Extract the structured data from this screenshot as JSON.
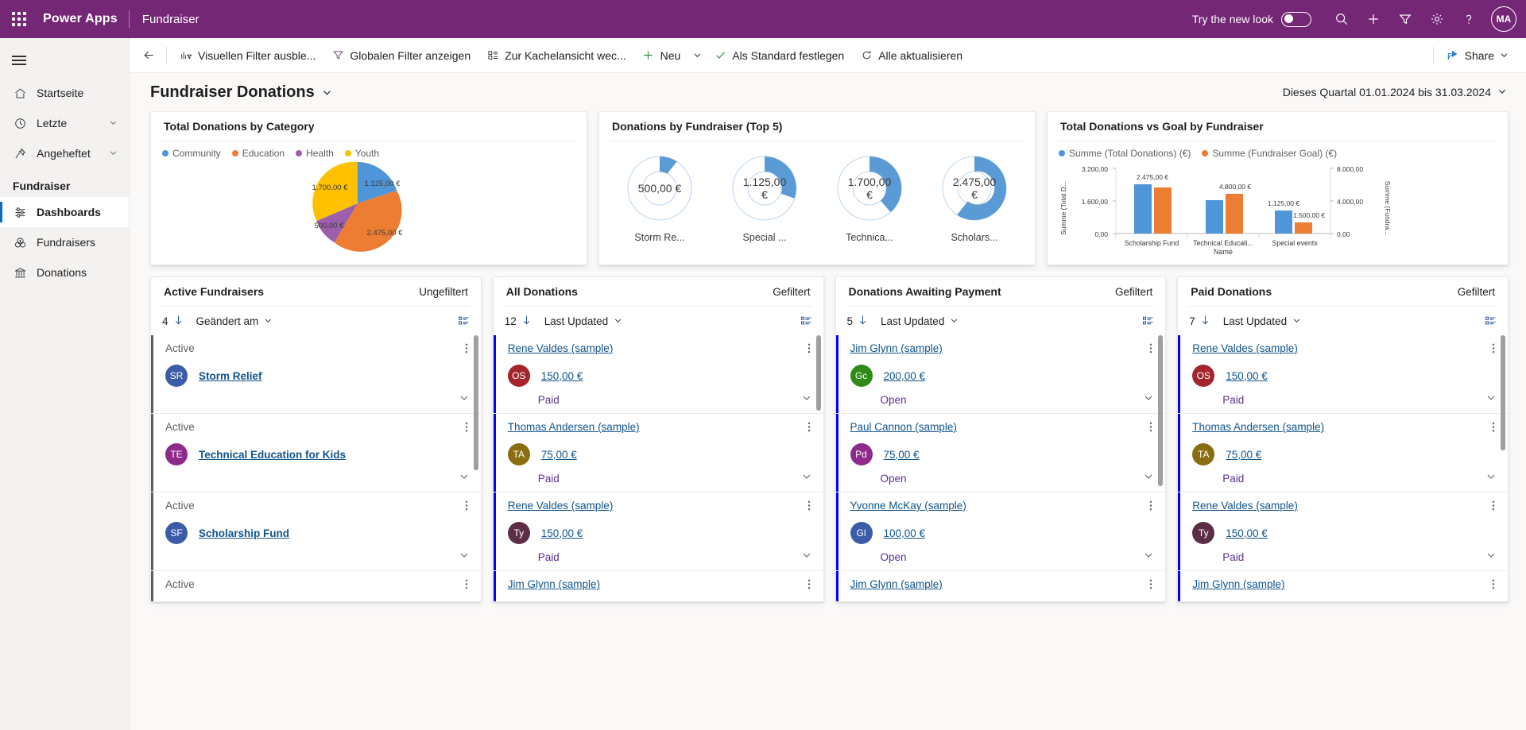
{
  "topbar": {
    "waffle_icon": "waffle-icon",
    "brand": "Power Apps",
    "app_name": "Fundraiser",
    "new_look_label": "Try the new look",
    "icons": [
      "search-icon",
      "plus-icon",
      "filter-icon",
      "gear-icon",
      "help-icon"
    ],
    "avatar_initials": "MA",
    "background_color": "#742774"
  },
  "sidebar": {
    "hamburger": "hamburger-icon",
    "items": [
      {
        "label": "Startseite",
        "icon": "home-icon",
        "chevron": false,
        "active": false
      },
      {
        "label": "Letzte",
        "icon": "clock-icon",
        "chevron": true,
        "active": false
      },
      {
        "label": "Angeheftet",
        "icon": "pin-icon",
        "chevron": true,
        "active": false
      }
    ],
    "section_label": "Fundraiser",
    "group_items": [
      {
        "label": "Dashboards",
        "icon": "dashboard-icon",
        "active": true
      },
      {
        "label": "Fundraisers",
        "icon": "money-icon",
        "active": false
      },
      {
        "label": "Donations",
        "icon": "bank-icon",
        "active": false
      }
    ]
  },
  "commandbar": {
    "back": "back-arrow-icon",
    "buttons": [
      {
        "label": "Visuellen Filter ausble...",
        "icon": "chart-filter-icon",
        "caret": false
      },
      {
        "label": "Globalen Filter anzeigen",
        "icon": "funnel-icon",
        "caret": false
      },
      {
        "label": "Zur Kachelansicht wec...",
        "icon": "tiles-icon",
        "caret": false
      },
      {
        "label": "Neu",
        "icon": "plus-icon",
        "caret": true
      },
      {
        "label": "Als Standard festlegen",
        "icon": "check-icon",
        "caret": false
      },
      {
        "label": "Alle aktualisieren",
        "icon": "refresh-icon",
        "caret": false
      }
    ],
    "share_label": "Share",
    "share_icon": "share-icon"
  },
  "dashboard": {
    "title": "Fundraiser Donations",
    "title_caret": "chevron-down-icon",
    "date_range": "Dieses Quartal 01.01.2024 bis 31.03.2024",
    "date_caret": "chevron-down-icon"
  },
  "chart_data": [
    {
      "type": "pie",
      "title": "Total Donations by Category",
      "categories": [
        "Community",
        "Education",
        "Health",
        "Youth"
      ],
      "values": [
        1125,
        2475,
        500,
        1700
      ],
      "labels": [
        "1.125,00 €",
        "2.475,00 €",
        "500,00 €",
        "1.700,00 €"
      ],
      "colors": [
        "#4e95d9",
        "#ec7d32",
        "#9c5fad",
        "#ffc000"
      ],
      "legend_position": "top"
    },
    {
      "type": "donut",
      "title": "Donations by Fundraiser (Top 5)",
      "categories": [
        "Storm Re...",
        "Special ...",
        "Technica...",
        "Scholars..."
      ],
      "values": [
        500,
        1125,
        1700,
        2475
      ],
      "labels": [
        "500,00 €",
        "1.125,00 €",
        "1.700,00 €",
        "2.475,00 €"
      ],
      "max": 3200,
      "arc_color": "#5b9bd5",
      "track_color": "#ffffff",
      "track_stroke": "#b9d5ef"
    },
    {
      "type": "bar",
      "title": "Total Donations vs Goal by Fundraiser",
      "categories": [
        "Scholarship Fund",
        "Technical Educati...",
        "Special events"
      ],
      "series": [
        {
          "name": "Summe (Total Donations) (€)",
          "color": "#4e95d9",
          "values": [
            2475,
            1650,
            1125
          ],
          "labels": [
            "2.475,00 €",
            "",
            "1.125,00 €"
          ]
        },
        {
          "name": "Summe (Fundraiser Goal) (€)",
          "color": "#ec7d32",
          "values": [
            6000,
            4800,
            1500
          ],
          "labels": [
            "",
            "4.800,00 €",
            "1.500,00 €"
          ]
        }
      ],
      "xlabel": "Name",
      "y_left_label": "Summe (Total D...",
      "y_right_label": "Summe (Fundra...",
      "y_left_ticks": [
        "0,00",
        "1.600,00",
        "3.200,00"
      ],
      "y_right_ticks": [
        "0,00",
        "4.000,00",
        "8.000,00"
      ],
      "ylim_left": [
        0,
        3200
      ],
      "ylim_right": [
        0,
        8000
      ],
      "grid": false,
      "legend_position": "top"
    }
  ],
  "lists": [
    {
      "title": "Active Fundraisers",
      "filter_status": "Ungefiltert",
      "count": "4",
      "sort_label": "Geändert am",
      "sort_icon": "sort-desc-icon",
      "view_icon": "list-view-icon",
      "accent": "grey",
      "rows": [
        {
          "header": "Active",
          "header_link": false,
          "initials": "SR",
          "avatar_color": "#3b5ca8",
          "name": "Storm Relief",
          "status": "",
          "kind": "fundraiser"
        },
        {
          "header": "Active",
          "header_link": false,
          "initials": "TE",
          "avatar_color": "#8e2a8b",
          "name": "Technical Education for Kids",
          "status": "",
          "kind": "fundraiser"
        },
        {
          "header": "Active",
          "header_link": false,
          "initials": "SF",
          "avatar_color": "#3b5ca8",
          "name": "Scholarship Fund",
          "status": "",
          "kind": "fundraiser"
        },
        {
          "header": "Active",
          "header_link": false,
          "initials": "",
          "avatar_color": "#3b5ca8",
          "name": "",
          "status": "",
          "kind": "fundraiser"
        }
      ]
    },
    {
      "title": "All Donations",
      "filter_status": "Gefiltert",
      "count": "12",
      "sort_label": "Last Updated",
      "sort_icon": "sort-desc-icon",
      "view_icon": "list-view-icon",
      "accent": "blue",
      "rows": [
        {
          "header": "Rene Valdes (sample)",
          "header_link": true,
          "initials": "OS",
          "avatar_color": "#a4262c",
          "name": "150,00 €",
          "status": "Paid",
          "kind": "donation"
        },
        {
          "header": "Thomas Andersen (sample)",
          "header_link": true,
          "initials": "TA",
          "avatar_color": "#8a6d10",
          "name": "75,00 €",
          "status": "Paid",
          "kind": "donation"
        },
        {
          "header": "Rene Valdes (sample)",
          "header_link": true,
          "initials": "Ty",
          "avatar_color": "#5c2e46",
          "name": "150,00 €",
          "status": "Paid",
          "kind": "donation"
        },
        {
          "header": "Jim Glynn (sample)",
          "header_link": true,
          "initials": "",
          "avatar_color": "#107c10",
          "name": "",
          "status": "",
          "kind": "donation"
        }
      ]
    },
    {
      "title": "Donations Awaiting Payment",
      "filter_status": "Gefiltert",
      "count": "5",
      "sort_label": "Last Updated",
      "sort_icon": "sort-desc-icon",
      "view_icon": "list-view-icon",
      "accent": "blue",
      "rows": [
        {
          "header": "Jim Glynn (sample)",
          "header_link": true,
          "initials": "Gc",
          "avatar_color": "#2e8b16",
          "name": "200,00 €",
          "status": "Open",
          "kind": "donation"
        },
        {
          "header": "Paul Cannon (sample)",
          "header_link": true,
          "initials": "Pd",
          "avatar_color": "#8e2a8b",
          "name": "75,00 €",
          "status": "Open",
          "kind": "donation"
        },
        {
          "header": "Yvonne McKay (sample)",
          "header_link": true,
          "initials": "Gl",
          "avatar_color": "#3b5ca8",
          "name": "100,00 €",
          "status": "Open",
          "kind": "donation"
        },
        {
          "header": "Jim Glynn (sample)",
          "header_link": true,
          "initials": "",
          "avatar_color": "#3b5ca8",
          "name": "",
          "status": "",
          "kind": "donation"
        }
      ]
    },
    {
      "title": "Paid Donations",
      "filter_status": "Gefiltert",
      "count": "7",
      "sort_label": "Last Updated",
      "sort_icon": "sort-desc-icon",
      "view_icon": "list-view-icon",
      "accent": "blue",
      "rows": [
        {
          "header": "Rene Valdes (sample)",
          "header_link": true,
          "initials": "OS",
          "avatar_color": "#a4262c",
          "name": "150,00 €",
          "status": "Paid",
          "kind": "donation"
        },
        {
          "header": "Thomas Andersen (sample)",
          "header_link": true,
          "initials": "TA",
          "avatar_color": "#8a6d10",
          "name": "75,00 €",
          "status": "Paid",
          "kind": "donation"
        },
        {
          "header": "Rene Valdes (sample)",
          "header_link": true,
          "initials": "Ty",
          "avatar_color": "#5c2e46",
          "name": "150,00 €",
          "status": "Paid",
          "kind": "donation"
        },
        {
          "header": "Jim Glynn (sample)",
          "header_link": true,
          "initials": "",
          "avatar_color": "#3b5ca8",
          "name": "",
          "status": "",
          "kind": "donation"
        }
      ]
    }
  ]
}
